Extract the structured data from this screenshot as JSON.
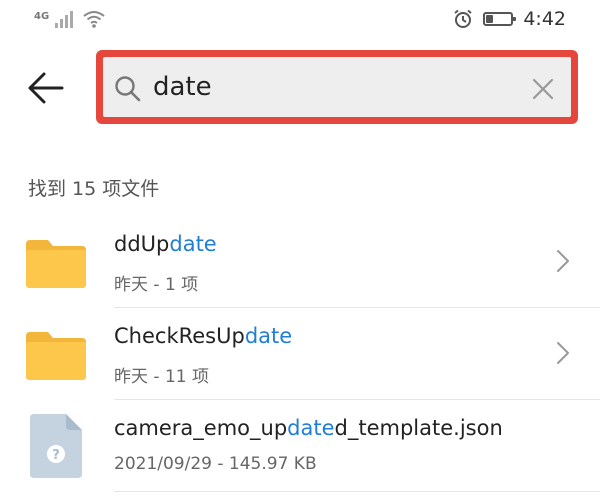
{
  "status_bar": {
    "network": "4G",
    "time": "4:42",
    "battery_level": 0.35
  },
  "search": {
    "query": "date"
  },
  "results": {
    "count_text": "找到 15 项文件",
    "items": [
      {
        "name_prefix": "ddUp",
        "name_highlight": "date",
        "name_suffix": "",
        "meta": "昨天 - 1 项",
        "type": "folder-icon"
      },
      {
        "name_prefix": "CheckResUp",
        "name_highlight": "date",
        "name_suffix": "",
        "meta": "昨天 - 11 项",
        "type": "folder-icon"
      },
      {
        "name_prefix": "camera_emo_up",
        "name_highlight": "date",
        "name_suffix": "d_template.json",
        "meta": "2021/09/29 - 145.97 KB",
        "type": "unknown-file-icon"
      }
    ]
  },
  "colors": {
    "highlight": "#1f7fd6",
    "folder": "#fcc74a",
    "search_border": "#e5473d"
  }
}
